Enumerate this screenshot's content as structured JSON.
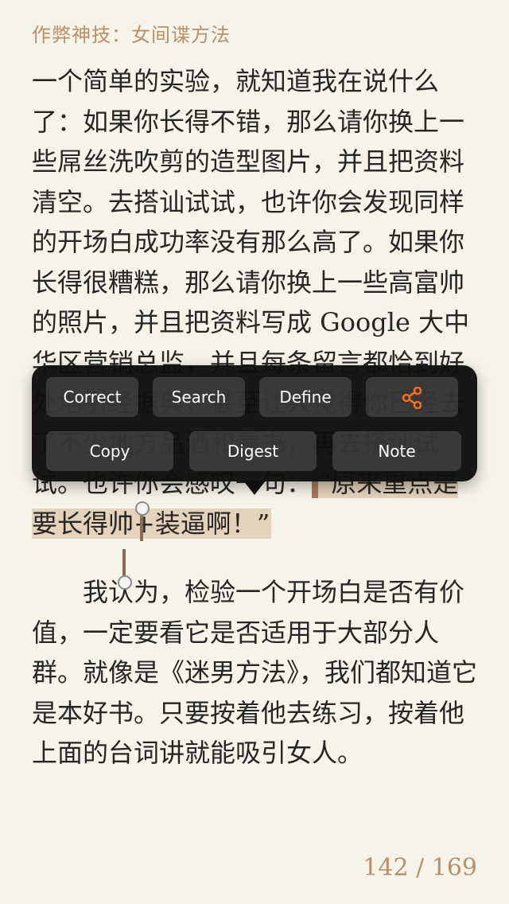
{
  "header": {
    "title": "作弊神技：女间谍方法"
  },
  "reader": {
    "paragraph1_before": "一个简单的实验，就知道我在说什么了：如果你长得不错，那么请你换上一些屌丝洗吹剪的造型图片，并且把资料清空。去搭讪试试，也许你会发现同样的开场白成功率没有那么高了。如果你长得很糟糕，那么请你换上一些高富帅的照片，并且把资料写成 Google 大中华区营销总监，并且每条留言都恰到好处地引经据典，甚至让人觉得你已经去了不少地方品酒和看书，再去搭讪试试。也许你会感叹一句：",
    "paragraph1_highlight": "“原来重点是要长得帅+装逼啊！”",
    "paragraph2": "我认为，检验一个开场白是否有价值，一定要看它是否适用于大部分人群。就像是《迷男方法》，我们都知道它是本好书。只要按着他去练习，按着他上面的台词讲就能吸引女人。"
  },
  "menu": {
    "correct": "Correct",
    "search": "Search",
    "define": "Define",
    "share_icon": "share-icon",
    "copy": "Copy",
    "digest": "Digest",
    "note": "Note"
  },
  "footer": {
    "page_indicator": "142 / 169"
  },
  "colors": {
    "background": "#f6f3ea",
    "accent": "#b98f68",
    "highlight": "#e4d2bb",
    "menu_background": "#101010",
    "menu_button": "#343434",
    "share_icon": "#ff6a1a"
  }
}
